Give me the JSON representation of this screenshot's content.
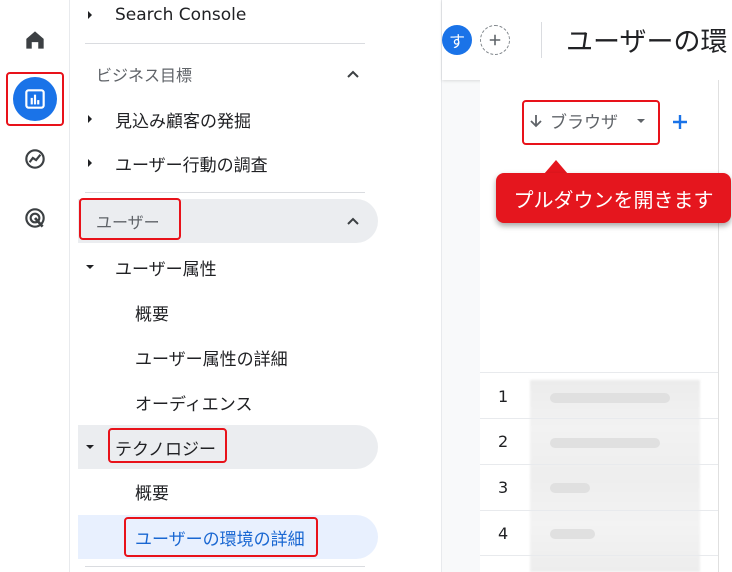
{
  "nav": {
    "search_console": "Search Console",
    "section_business": "ビジネス目標",
    "lead_gen": "見込み顧客の発掘",
    "user_behavior": "ユーザー行動の調査",
    "section_user": "ユーザー",
    "demographics": "ユーザー属性",
    "demo_overview": "概要",
    "demo_details": "ユーザー属性の詳細",
    "audiences": "オーディエンス",
    "technology": "テクノロジー",
    "tech_overview": "概要",
    "tech_details": "ユーザーの環境の詳細"
  },
  "header": {
    "avatar_letter": "す",
    "title": "ユーザーの環"
  },
  "table": {
    "dimension_label": "ブラウザ",
    "row_numbers": [
      "1",
      "2",
      "3",
      "4"
    ]
  },
  "callout": {
    "text": "プルダウンを開きます"
  },
  "colors": {
    "accent": "#1a73e8",
    "highlight": "#e8121a",
    "callout_bg": "#e5161e"
  },
  "icons": {
    "rail": [
      "home-icon",
      "reports-icon",
      "explore-icon",
      "advertising-icon"
    ]
  }
}
